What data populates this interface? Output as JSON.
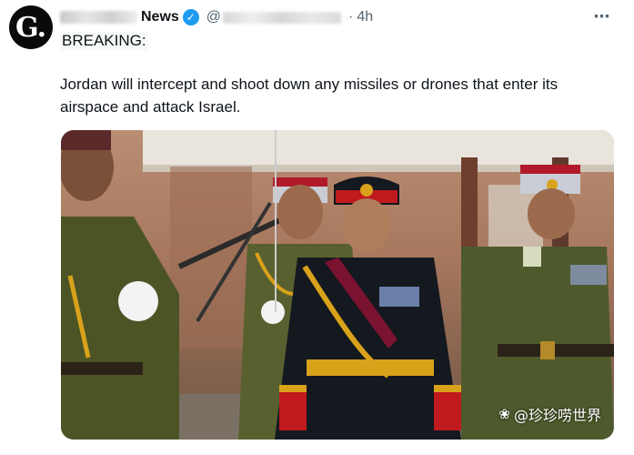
{
  "post": {
    "avatar_letter": "G",
    "avatar_dot": ".",
    "account_name": "News",
    "at_sign": "@",
    "separator": "·",
    "time": "4h",
    "more_icon": "⋯",
    "verified_icon": "✓",
    "label": "BREAKING:",
    "text": "Jordan will intercept and shoot down any missiles or drones that enter its airspace and attack Israel."
  },
  "media": {
    "description_icon": "photo",
    "watermark_icon": "❀",
    "watermark": "@珍珍唠世界"
  },
  "colors": {
    "verified": "#1d9bf0",
    "text": "#0f1419",
    "muted": "#536471",
    "uniform_green": "#4c5426",
    "uniform_black": "#14181f",
    "gold": "#d9a21b",
    "red": "#c01a1f"
  }
}
